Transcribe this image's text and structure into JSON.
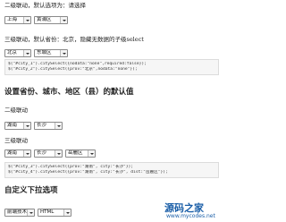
{
  "section1": {
    "title": "二级联动，默认选项为：请选择",
    "province": "上海",
    "city": "黄浦区"
  },
  "section2": {
    "title": "三级联动，默认省份：北京，隐藏无数据的子级select",
    "province": "北京",
    "city": "东城区",
    "code": [
      "$(\"#city_1\").citySelect({nodata:\"none\",required:false});",
      "$(\"#city_2\").citySelect({prov:\"北京\",nodata:\"none\"});"
    ]
  },
  "heading_default": "设置省份、城市、地区（县）的默认值",
  "section3": {
    "title": "二级联动",
    "province": "湖南",
    "city": "长沙"
  },
  "section4": {
    "title": "三级联动",
    "province": "湖南",
    "city": "长沙",
    "district": "岳麓区",
    "code": [
      "$(\"#city_3\").citySelect({prov:\"湖南\", city:\"长沙\"});",
      "$(\"#city_4\").citySelect({prov:\"湖南\", city:\"长沙\", dist:\"岳麓区\"});"
    ]
  },
  "heading_custom": "自定义下拉选项",
  "section5": {
    "first": "前端技术",
    "second": "HTML"
  },
  "watermark": {
    "brand": "源码之家",
    "url": "www.mycodes.net"
  }
}
